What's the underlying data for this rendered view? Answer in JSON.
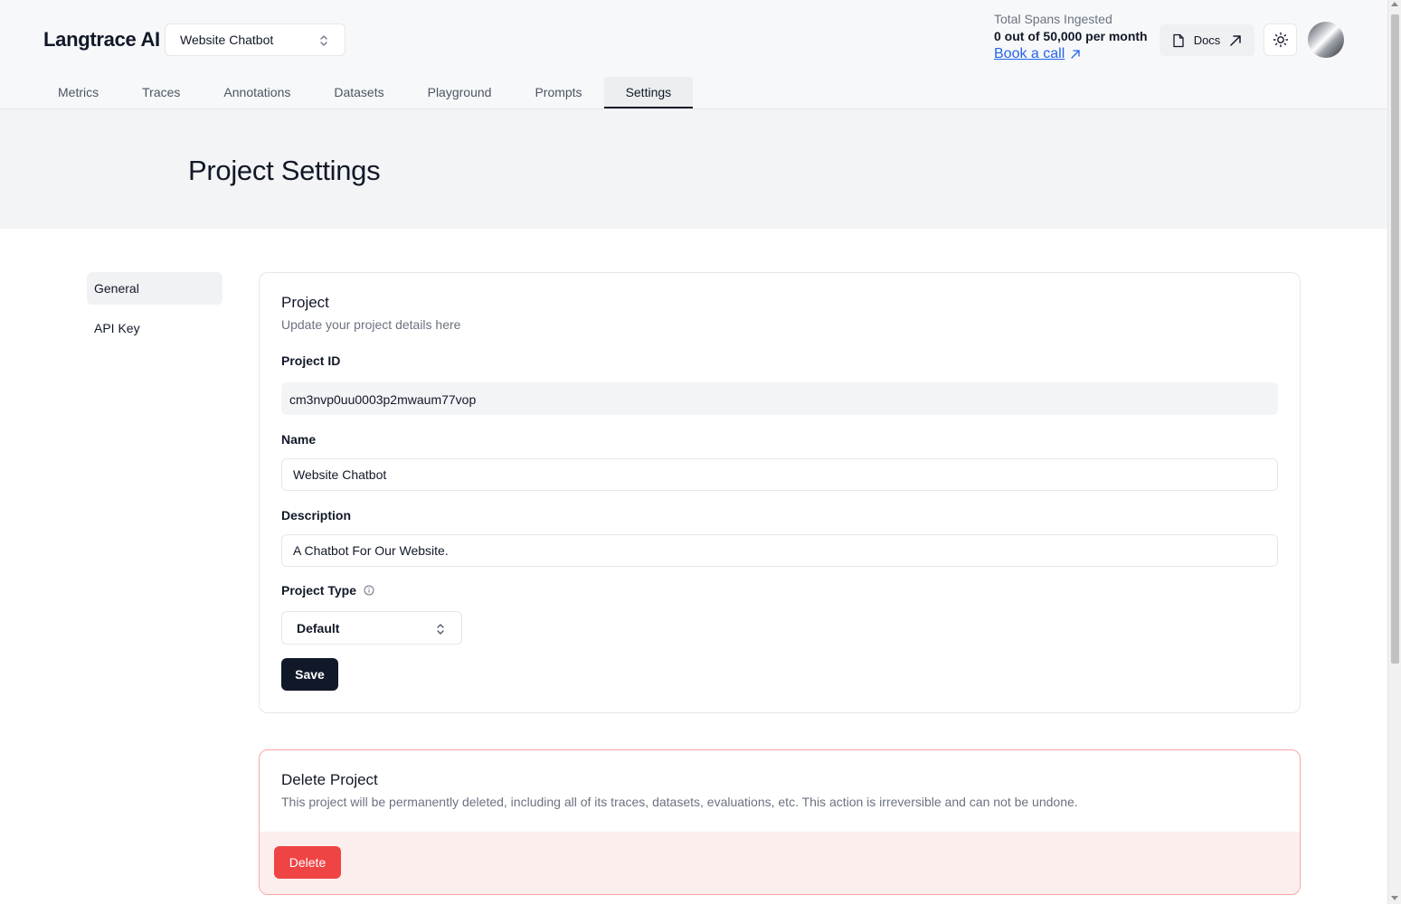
{
  "header": {
    "logo": "Langtrace AI",
    "project_selector": "Website Chatbot",
    "spans_title": "Total Spans Ingested",
    "spans_value": "0 out of 50,000 per month",
    "book_call": "Book a call",
    "docs_label": "Docs"
  },
  "tabs": [
    {
      "label": "Metrics"
    },
    {
      "label": "Traces"
    },
    {
      "label": "Annotations"
    },
    {
      "label": "Datasets"
    },
    {
      "label": "Playground"
    },
    {
      "label": "Prompts"
    },
    {
      "label": "Settings",
      "active": true
    }
  ],
  "page_title": "Project Settings",
  "side_nav": [
    {
      "label": "General",
      "active": true
    },
    {
      "label": "API Key"
    }
  ],
  "project_card": {
    "title": "Project",
    "subtitle": "Update your project details here",
    "project_id_label": "Project ID",
    "project_id_value": "cm3nvp0uu0003p2mwaum77vop",
    "name_label": "Name",
    "name_value": "Website Chatbot",
    "description_label": "Description",
    "description_value": "A Chatbot For Our Website.",
    "project_type_label": "Project Type",
    "project_type_value": "Default",
    "save_label": "Save"
  },
  "delete_card": {
    "title": "Delete Project",
    "subtitle": "This project will be permanently deleted, including all of its traces, datasets, evaluations, etc. This action is irreversible and can not be undone.",
    "delete_label": "Delete"
  },
  "colors": {
    "primary": "#111827",
    "danger": "#ef4444",
    "link": "#2563eb"
  }
}
